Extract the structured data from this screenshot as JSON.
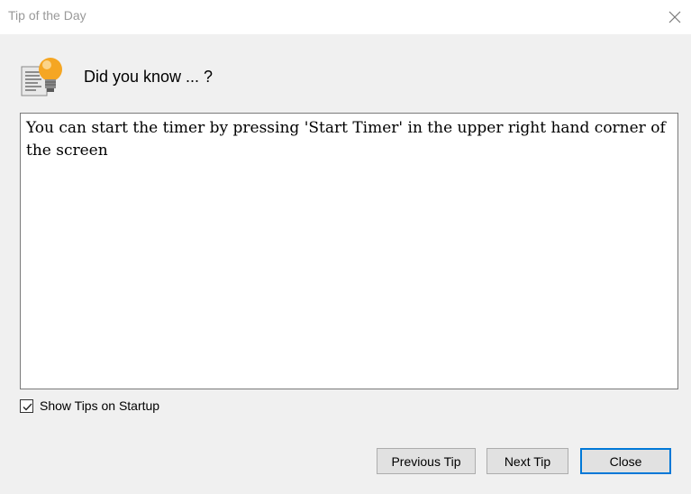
{
  "window": {
    "title": "Tip of the Day"
  },
  "icons": {
    "header": "lightbulb-icon",
    "close": "close-icon",
    "checkbox": "checkmark-icon"
  },
  "header": {
    "text": "Did you know  ... ?"
  },
  "tip": {
    "text": "You can start the timer by pressing 'Start Timer' in the upper right hand corner of the screen"
  },
  "options": {
    "show_tips_label": "Show Tips on Startup",
    "show_tips_checked": true
  },
  "buttons": {
    "previous_label": "Previous Tip",
    "next_label": "Next Tip",
    "close_label": "Close"
  },
  "colors": {
    "accent": "#0078d7",
    "bulb": "#f5a623"
  }
}
